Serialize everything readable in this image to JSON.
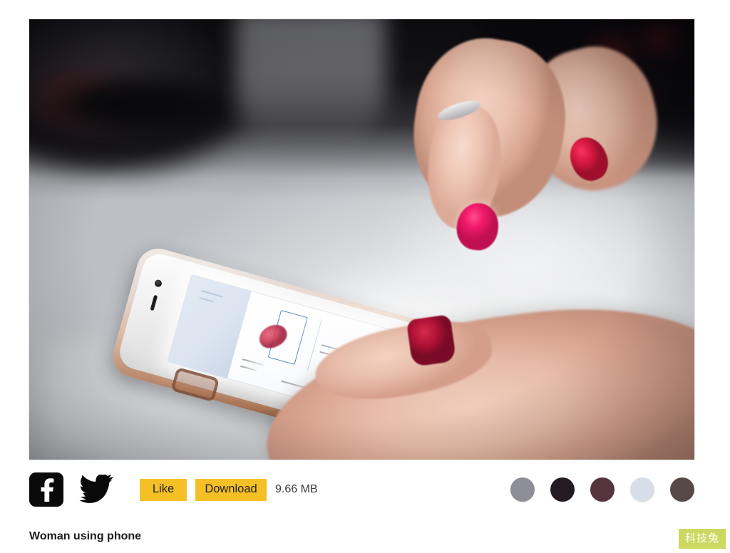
{
  "photo": {
    "alt": "Woman using phone",
    "subject": "woman-hands-holding-white-iphone-in-rose-gold-case-index-finger-tapping-bright-screen",
    "background": "blurred white desk with dark objects in upper corners"
  },
  "actionbar": {
    "facebook_icon": "facebook-icon",
    "twitter_icon": "twitter-icon",
    "like_label": "Like",
    "download_label": "Download",
    "filesize": "9.66 MB",
    "button_color": "#f5c026"
  },
  "swatches": [
    {
      "name": "swatch-gray",
      "color": "#8e8e98"
    },
    {
      "name": "swatch-near-black",
      "color": "#231a22"
    },
    {
      "name": "swatch-plum",
      "color": "#55343e"
    },
    {
      "name": "swatch-pale-blue",
      "color": "#d8dee8"
    },
    {
      "name": "swatch-brown",
      "color": "#554a45"
    }
  ],
  "caption": {
    "title": "Woman using phone"
  },
  "watermark": {
    "label": "科技兔",
    "color": "#ccd860"
  }
}
